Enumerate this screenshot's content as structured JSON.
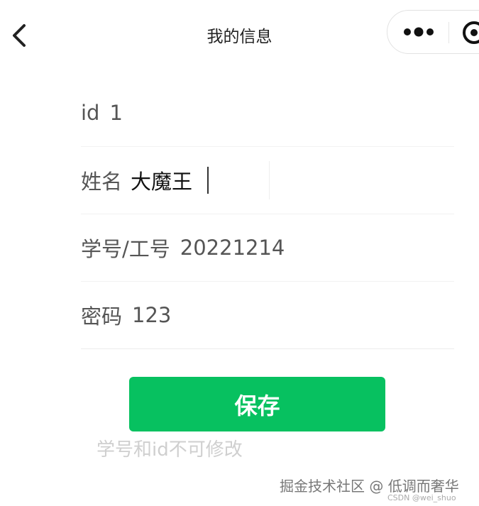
{
  "nav": {
    "title": "我的信息",
    "back_icon": "chevron-left-icon",
    "more_icon": "more-dots-icon",
    "close_icon": "close-circle-icon"
  },
  "form": {
    "id": {
      "label": "id",
      "value": "1"
    },
    "name": {
      "label": "姓名",
      "value": "大魔王"
    },
    "student_no": {
      "label": "学号/工号",
      "value": "20221214"
    },
    "password": {
      "label": "密码",
      "value": "123"
    }
  },
  "actions": {
    "save_label": "保存",
    "hint": "学号和id不可修改"
  },
  "watermark": {
    "main": "掘金技术社区 @ 低调而奢华",
    "sub": "CSDN @wei_shuo"
  },
  "colors": {
    "accent": "#07c160",
    "hint": "#cfcfcf"
  }
}
